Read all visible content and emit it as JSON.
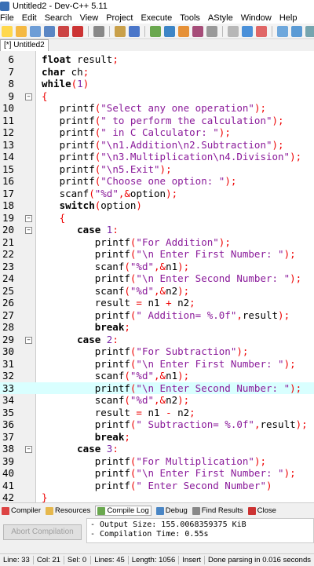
{
  "window": {
    "title": "Untitled2 - Dev-C++ 5.11"
  },
  "menu": [
    "File",
    "Edit",
    "Search",
    "View",
    "Project",
    "Execute",
    "Tools",
    "AStyle",
    "Window",
    "Help"
  ],
  "tabs": [
    {
      "label": "[*] Untitled2"
    }
  ],
  "editor": {
    "lines": [
      {
        "n": "6",
        "t": "    float result;"
      },
      {
        "n": "7",
        "t": "    char ch;"
      },
      {
        "n": "8",
        "t": "    while(1)"
      },
      {
        "n": "9",
        "t": "    {"
      },
      {
        "n": "10",
        "t": "       printf(\"Select any one operation\");"
      },
      {
        "n": "11",
        "t": "       printf(\" to perform the calculation\");"
      },
      {
        "n": "12",
        "t": "       printf(\" in C Calculator: \");"
      },
      {
        "n": "13",
        "t": "       printf(\"\\n1.Addition\\n2.Subtraction\");"
      },
      {
        "n": "14",
        "t": "       printf(\"\\n3.Multiplication\\n4.Division\");"
      },
      {
        "n": "15",
        "t": "       printf(\"\\n5.Exit\");"
      },
      {
        "n": "16",
        "t": "       printf(\"Choose one option: \");"
      },
      {
        "n": "17",
        "t": "       scanf(\"%d\",&option);"
      },
      {
        "n": "18",
        "t": "       switch(option)"
      },
      {
        "n": "19",
        "t": "       {"
      },
      {
        "n": "20",
        "t": "          case 1:"
      },
      {
        "n": "21",
        "t": "             printf(\"For Addition\");"
      },
      {
        "n": "22",
        "t": "             printf(\"\\n Enter First Number: \");"
      },
      {
        "n": "23",
        "t": "             scanf(\"%d\",&n1);"
      },
      {
        "n": "24",
        "t": "             printf(\"\\n Enter Second Number: \");"
      },
      {
        "n": "25",
        "t": "             scanf(\"%d\",&n2);"
      },
      {
        "n": "26",
        "t": "             result = n1 + n2;"
      },
      {
        "n": "27",
        "t": "             printf(\" Addition= %.0f\",result);"
      },
      {
        "n": "28",
        "t": "             break;"
      },
      {
        "n": "29",
        "t": "          case 2:"
      },
      {
        "n": "30",
        "t": "             printf(\"For Subtraction\");"
      },
      {
        "n": "31",
        "t": "             printf(\"\\n Enter First Number: \");"
      },
      {
        "n": "32",
        "t": "             scanf(\"%d\",&n1);"
      },
      {
        "n": "33",
        "t": "             printf(\"\\n Enter Second Number: \");"
      },
      {
        "n": "34",
        "t": "             scanf(\"%d\",&n2);"
      },
      {
        "n": "35",
        "t": "             result = n1 - n2;"
      },
      {
        "n": "36",
        "t": "             printf(\" Subtraction= %.0f\",result);"
      },
      {
        "n": "37",
        "t": "             break;"
      },
      {
        "n": "38",
        "t": "          case 3:"
      },
      {
        "n": "39",
        "t": "             printf(\"For Multiplication\");"
      },
      {
        "n": "40",
        "t": "             printf(\"\\n Enter First Number: \");"
      },
      {
        "n": "41",
        "t": "             printf(\" Enter Second Number\")"
      },
      {
        "n": "42",
        "t": "    }"
      }
    ],
    "highlight_line": "33"
  },
  "bottom_tabs": [
    "Compiler",
    "Resources",
    "Compile Log",
    "Debug",
    "Find Results",
    "Close"
  ],
  "log": {
    "abort_label": "Abort Compilation",
    "lines": [
      "- Output Size: 155.0068359375 KiB",
      "- Compilation Time: 0.55s"
    ]
  },
  "status": {
    "line": "Line: 33",
    "col": "Col: 21",
    "sel": "Sel: 0",
    "lines": "Lines: 45",
    "length": "Length: 1056",
    "mode": "Insert",
    "msg": "Done parsing in 0.016 seconds"
  },
  "colors": {
    "string": "#8a1a9a",
    "highlight": "#d9ffff"
  }
}
